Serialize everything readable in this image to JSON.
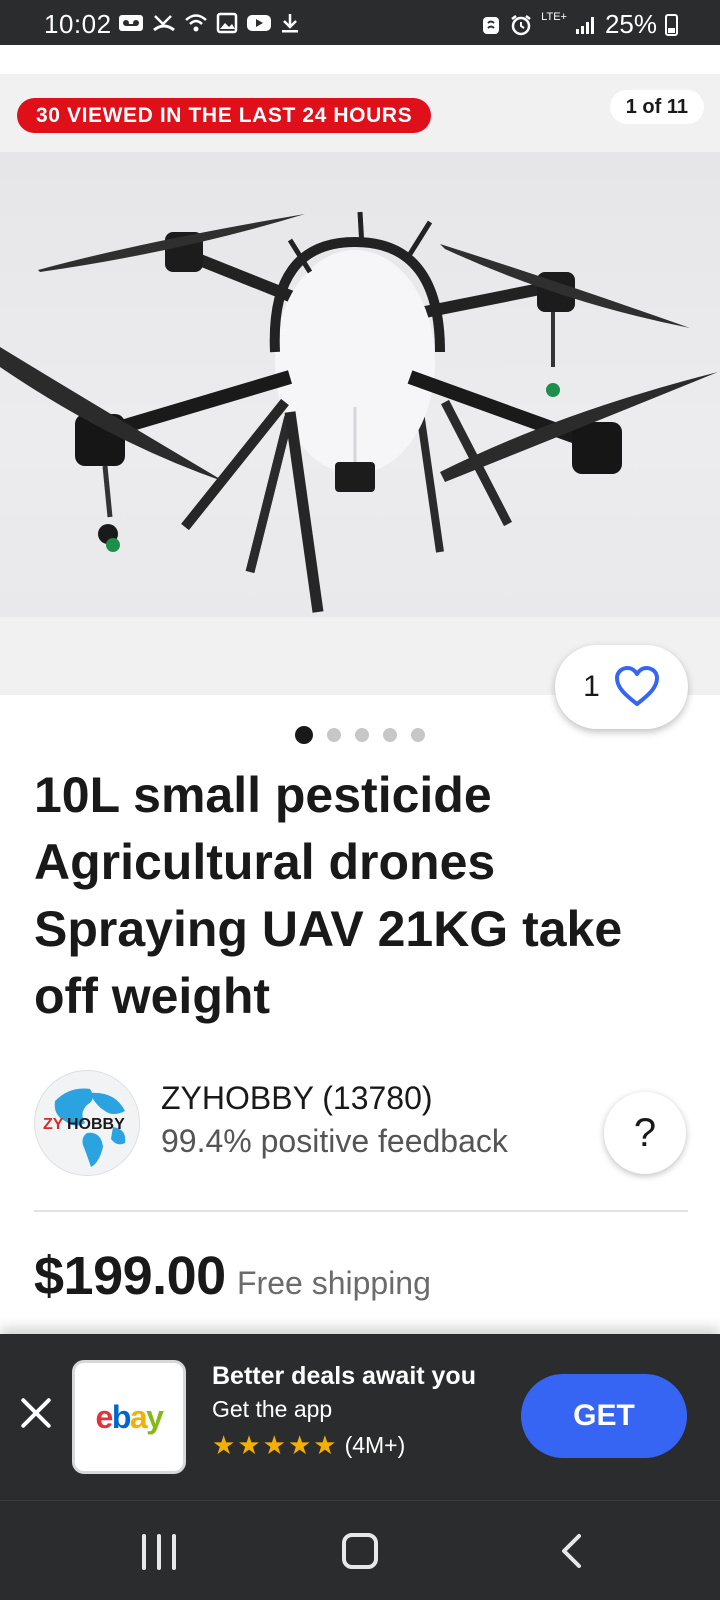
{
  "status_bar": {
    "time": "10:02",
    "network": "LTE+",
    "battery": "25%",
    "left_icons": [
      "voicemail-icon",
      "missed-call-icon",
      "wifi-icon",
      "image-icon",
      "youtube-icon",
      "download-icon"
    ],
    "right_icons": [
      "nfc-icon",
      "alarm-icon",
      "signal-icon",
      "battery-icon"
    ]
  },
  "gallery": {
    "viewed_badge": "30 VIEWED IN THE LAST 24 HOURS",
    "counter": "1 of 11",
    "dots_total": 5,
    "dots_active": 0
  },
  "watch": {
    "count": "1",
    "icon": "heart-icon"
  },
  "listing": {
    "title": "10L small pesticide Agricultural drones Spraying UAV 21KG take off weight"
  },
  "seller": {
    "logo_text_zy": "ZY",
    "logo_text_hobby": "HOBBY",
    "name": "ZYHOBBY (13780)",
    "feedback": "99.4% positive feedback",
    "help_label": "?"
  },
  "price": {
    "amount": "$199.00",
    "shipping": "Free shipping"
  },
  "app_banner": {
    "title": "Better deals await you",
    "subtitle": "Get the app",
    "rating_stars": 5,
    "rating_count": "(4M+)",
    "get_label": "GET",
    "logo": {
      "e": "e",
      "b": "b",
      "a": "a",
      "y": "y"
    }
  },
  "colors": {
    "badge_red": "#e0101a",
    "accent_blue": "#3665f3",
    "dark_bar": "#2b2c2e",
    "star_gold": "#f5af02"
  }
}
